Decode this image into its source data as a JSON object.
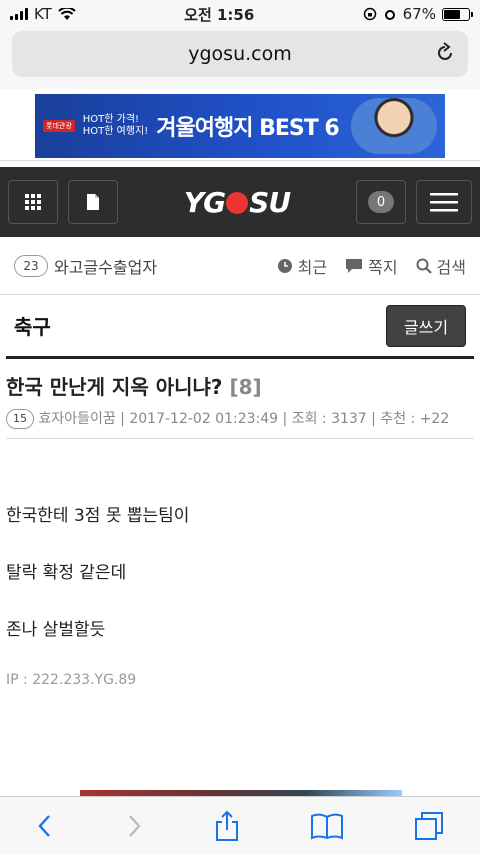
{
  "status": {
    "carrier": "KT",
    "time": "오전 1:56",
    "battery": "67%",
    "battery_level": 0.67
  },
  "browser": {
    "url": "ygosu.com"
  },
  "ad_banner": {
    "brand": "롯데관광",
    "line1": "HOT한 가격!",
    "line2": "HOT한 여행지!",
    "headline": "겨울여행지 BEST 6"
  },
  "nav": {
    "logo_pre": "YG",
    "logo_post": "SU",
    "notification_count": "0"
  },
  "subnav": {
    "level": "23",
    "username": "와고글수출업자",
    "recent": "최근",
    "message": "쪽지",
    "search": "검색"
  },
  "board": {
    "title": "축구",
    "write_button": "글쓰기"
  },
  "post": {
    "title": "한국 만난게 지옥 아니냐?",
    "comment_count": "[8]",
    "author_level": "15",
    "author": "효자아들이꿈",
    "date": "2017-12-02 01:23:49",
    "views": "조회 : 3137",
    "recommend": "추천 : +22",
    "lines": [
      "한국한테 3점 못 뽑는팀이",
      "탈락 확정 같은데",
      "존나 살벌할듯"
    ],
    "ip": "IP : 222.233.YG.89"
  }
}
